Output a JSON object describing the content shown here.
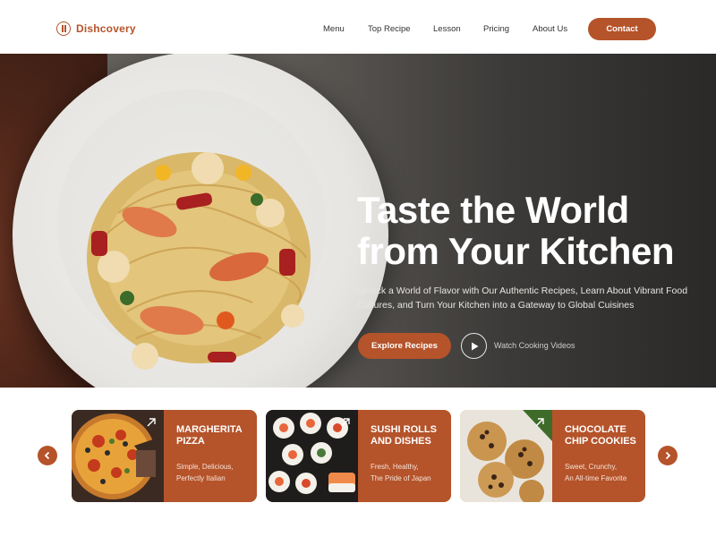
{
  "brand": {
    "name": "Dishcovery"
  },
  "nav": {
    "links": [
      "Menu",
      "Top Recipe",
      "Lesson",
      "Pricing",
      "About Us"
    ],
    "contact_label": "Contact"
  },
  "hero": {
    "title_line1": "Taste the World",
    "title_line2": "from Your Kitchen",
    "subtitle": "Unlock a World of Flavor with Our Authentic Recipes, Learn About Vibrant Food Cultures, and Turn Your Kitchen into a Gateway to Global Cuisines",
    "explore_label": "Explore Recipes",
    "watch_label": "Watch Cooking Videos"
  },
  "cards": [
    {
      "title": "MARGHERITA PIZZA",
      "desc1": "Simple, Delicious,",
      "desc2": "Perfectly Italian"
    },
    {
      "title": "SUSHI ROLLS AND DISHES",
      "desc1": "Fresh, Healthy,",
      "desc2": "The Pride of Japan"
    },
    {
      "title": "CHOCOLATE CHIP COOKIES",
      "desc1": "Sweet, Crunchy,",
      "desc2": "An All-time Favorite"
    }
  ],
  "colors": {
    "accent": "#b5532a",
    "hero_dark": "#2a2928",
    "white": "#ffffff"
  },
  "icons": {
    "logo": "fork-spoon-icon",
    "play": "play-icon",
    "prev": "chevron-left-icon",
    "next": "chevron-right-icon",
    "corner": "arrow-up-right-icon"
  }
}
